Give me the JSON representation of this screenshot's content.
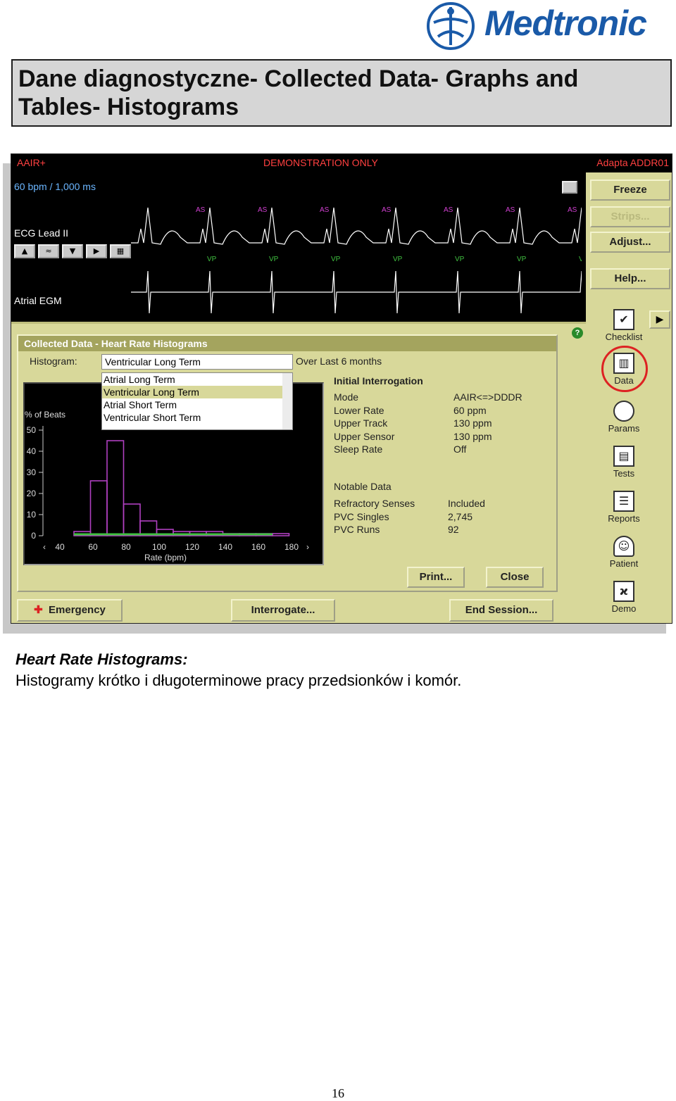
{
  "header": {
    "logo_text": "Medtronic",
    "title": "Dane diagnostyczne- Collected Data- Graphs and Tables- Histograms"
  },
  "screen": {
    "topbar": {
      "left": "AAIR+",
      "center": "DEMONSTRATION ONLY",
      "right": "Adapta ADDR01"
    },
    "ecg": {
      "rate": "60 bpm / 1,000 ms",
      "lead_label": "ECG Lead II",
      "egm_label": "Atrial EGM",
      "marker_as": "AS",
      "marker_vp": "VP"
    },
    "right_buttons": {
      "freeze": "Freeze",
      "strips": "Strips...",
      "adjust": "Adjust...",
      "help": "Help..."
    },
    "side_icons": {
      "checklist": "Checklist",
      "data": "Data",
      "params": "Params",
      "tests": "Tests",
      "reports": "Reports",
      "patient": "Patient",
      "demo": "Demo"
    },
    "dialog": {
      "title": "Collected Data - Heart Rate Histograms",
      "histogram_label": "Histogram:",
      "histogram_selected": "Ventricular Long Term",
      "period": "Over Last 6 months",
      "options": [
        "Atrial Long Term",
        "Ventricular Long Term",
        "Atrial Short Term",
        "Ventricular Short Term"
      ],
      "initial_title": "Initial Interrogation",
      "initial_rows": [
        {
          "label": "Mode",
          "value": "AAIR<=>DDDR"
        },
        {
          "label": "Lower Rate",
          "value": "60 ppm"
        },
        {
          "label": "Upper Track",
          "value": "130 ppm"
        },
        {
          "label": "Upper Sensor",
          "value": "130 ppm"
        },
        {
          "label": "Sleep Rate",
          "value": "Off"
        }
      ],
      "notable_title": "Notable Data",
      "notable_rows": [
        {
          "label": "Refractory Senses",
          "value": "Included"
        },
        {
          "label": "PVC Singles",
          "value": "2,745"
        },
        {
          "label": "PVC Runs",
          "value": "92"
        }
      ],
      "print_label": "Print...",
      "close_label": "Close"
    },
    "bottom_buttons": {
      "emergency": "Emergency",
      "interrogate": "Interrogate...",
      "end_session": "End Session..."
    }
  },
  "chart_data": {
    "type": "bar",
    "ylabel": "% of Beats",
    "xlabel": "Rate (bpm)",
    "ylim": [
      0,
      50
    ],
    "yticks": [
      0,
      10,
      20,
      30,
      40,
      50
    ],
    "xticks": [
      40,
      60,
      80,
      100,
      120,
      140,
      160,
      180
    ],
    "bar_edges": [
      60,
      70,
      80,
      90,
      100,
      110,
      120,
      130,
      140,
      150,
      160,
      170,
      180,
      190
    ],
    "values": [
      2,
      26,
      45,
      15,
      7,
      3,
      2,
      2,
      2,
      1,
      1,
      1,
      1
    ],
    "colors": {
      "bars": "#b040c0",
      "baseline": "#40c040"
    }
  },
  "caption": {
    "title": "Heart Rate Histograms:",
    "text": "Histogramy krótko i długoterminowe pracy przedsionków i komór."
  },
  "page_number": "16"
}
